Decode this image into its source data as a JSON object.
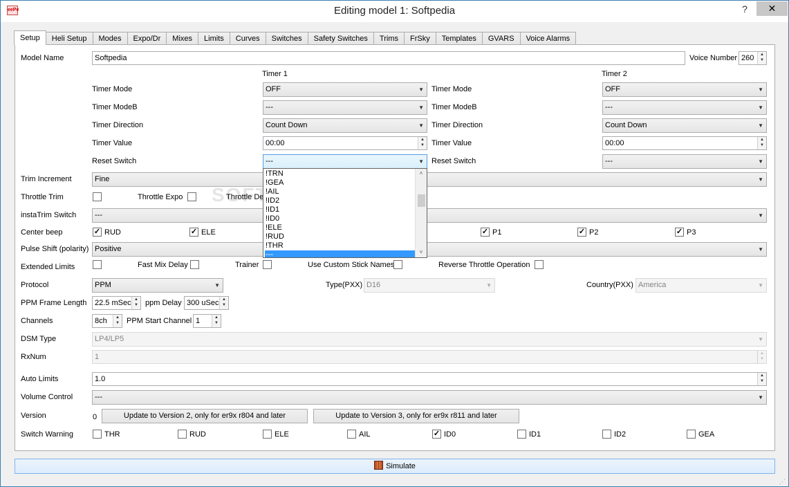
{
  "window": {
    "title": "Editing model 1: Softpedia",
    "app_icon_text": "eePe",
    "help_label": "?",
    "close_label": "✕"
  },
  "tabs": [
    "Setup",
    "Heli Setup",
    "Modes",
    "Expo/Dr",
    "Mixes",
    "Limits",
    "Curves",
    "Switches",
    "Safety Switches",
    "Trims",
    "FrSky",
    "Templates",
    "GVARS",
    "Voice Alarms"
  ],
  "active_tab": "Setup",
  "setup": {
    "model_name_label": "Model Name",
    "model_name_value": "Softpedia",
    "voice_number_label": "Voice Number",
    "voice_number_value": "260",
    "timer1": {
      "header": "Timer 1",
      "mode_label": "Timer Mode",
      "mode": "OFF",
      "modeb_label": "Timer ModeB",
      "modeb": "---",
      "direction_label": "Timer Direction",
      "direction": "Count Down",
      "value_label": "Timer Value",
      "value": "00:00",
      "reset_label": "Reset Switch",
      "reset": "---"
    },
    "timer2": {
      "header": "Timer 2",
      "mode_label": "Timer Mode",
      "mode": "OFF",
      "modeb_label": "Timer ModeB",
      "modeb": "---",
      "direction_label": "Timer Direction",
      "direction": "Count Down",
      "value_label": "Timer Value",
      "value": "00:00",
      "reset_label": "Reset Switch",
      "reset": "---"
    },
    "trim_increment_label": "Trim Increment",
    "trim_increment": "Fine",
    "throttle_trim_label": "Throttle Trim",
    "throttle_expo_label": "Throttle Expo",
    "throttle_de_label": "Throttle De",
    "instatrim_label": "instaTrim Switch",
    "instatrim": "---",
    "center_beep_label": "Center beep",
    "center_beep": [
      {
        "label": "RUD",
        "checked": true
      },
      {
        "label": "ELE",
        "checked": true
      },
      {
        "label": "P1",
        "checked": true
      },
      {
        "label": "P2",
        "checked": true
      },
      {
        "label": "P3",
        "checked": true
      }
    ],
    "pulse_shift_label": "Pulse Shift (polarity)",
    "pulse_shift": "Positive",
    "extended_limits_label": "Extended Limits",
    "fast_mix_delay_label": "Fast Mix Delay",
    "trainer_label": "Trainer",
    "custom_stick_label": "Use Custom Stick Names",
    "reverse_throttle_label": "Reverse Throttle Operation",
    "protocol_label": "Protocol",
    "protocol": "PPM",
    "type_pxx_label": "Type(PXX)",
    "type_pxx": "D16",
    "country_pxx_label": "Country(PXX)",
    "country_pxx": "America",
    "ppm_frame_label": "PPM Frame Length",
    "ppm_frame": "22.5 mSec",
    "ppm_delay_label": "ppm Delay",
    "ppm_delay": "300 uSec",
    "channels_label": "Channels",
    "channels": "8ch",
    "ppm_start_label": "PPM Start Channel",
    "ppm_start": "1",
    "dsm_type_label": "DSM Type",
    "dsm_type": "LP4/LP5",
    "rxnum_label": "RxNum",
    "rxnum": "1",
    "auto_limits_label": "Auto Limits",
    "auto_limits": "1.0",
    "volume_label": "Volume Control",
    "volume": "---",
    "version_label": "Version",
    "version_value": "0",
    "update_v2_label": "Update to Version 2, only for er9x r804 and later",
    "update_v3_label": "Update to Version 3, only for er9x r811 and later",
    "switch_warning_label": "Switch Warning",
    "switch_warning": [
      {
        "label": "THR",
        "checked": false
      },
      {
        "label": "RUD",
        "checked": false
      },
      {
        "label": "ELE",
        "checked": false
      },
      {
        "label": "AIL",
        "checked": false
      },
      {
        "label": "ID0",
        "checked": true
      },
      {
        "label": "ID1",
        "checked": false
      },
      {
        "label": "ID2",
        "checked": false
      },
      {
        "label": "GEA",
        "checked": false
      }
    ]
  },
  "dropdown_options": [
    "!TRN",
    "!GEA",
    "!AIL",
    "!ID2",
    "!ID1",
    "!ID0",
    "!ELE",
    "!RUD",
    "!THR",
    "---"
  ],
  "dropdown_selected": "---",
  "watermark": "SOFTPEDIA",
  "simulate_label": "Simulate",
  "icons": {
    "combo_arrow": "▼",
    "spin_up": "▲",
    "spin_down": "▼",
    "check": "✓",
    "scroll_up": "˄",
    "scroll_down": "˅",
    "grip": "⋰"
  }
}
